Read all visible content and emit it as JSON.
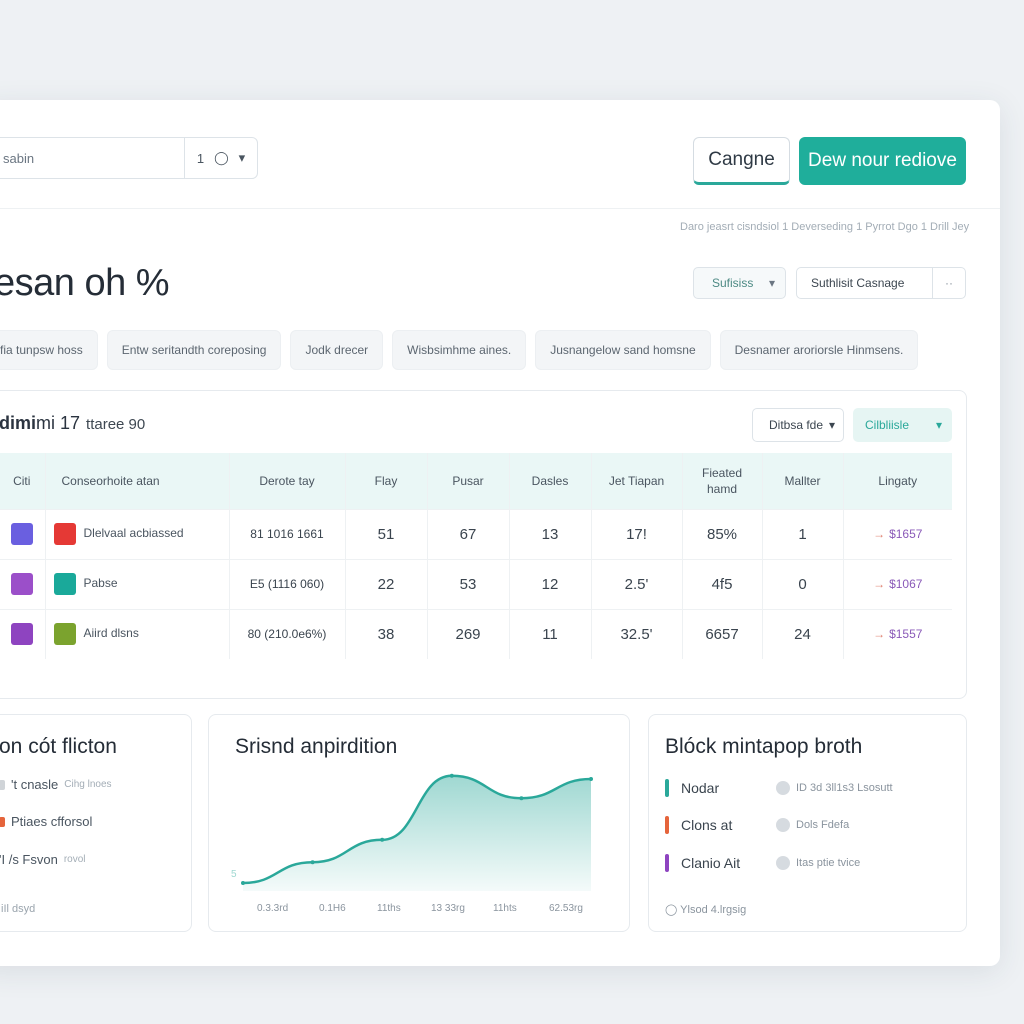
{
  "search": {
    "value": "sabin",
    "stepper_value": "1"
  },
  "actions": {
    "secondary_label": "Cangne",
    "primary_label": "Dew nour rediove"
  },
  "breadcrumbs": "Daro jeasrt  cisndsiol  1  Deverseding  1  Pyrrot Dgo  1  Drill Jey",
  "page_title": "esan oh %",
  "header_selects": {
    "left": "Sufisiss",
    "right": "Suthlisit Casnage"
  },
  "filters": [
    "fia tunpsw hoss",
    "Entw seritandth coreposing",
    "Jodk drecer",
    "Wisbsimhme aines.",
    "Jusnangelow sand homsne",
    "Desnamer aroriorsle Hinmsens."
  ],
  "table_panel": {
    "title_bold": "dimi",
    "title_text": "mi 17",
    "title_sub": "ttaree 90",
    "select1": "Ditbsa fde",
    "select2": "Cilbliisle",
    "columns": [
      "Citi",
      "Conseorhoite atan",
      "Derote tay",
      "Flay",
      "Pusar",
      "Dasles",
      "Jet Tiapan",
      "Fieated hamd",
      "Mallter",
      "Lingaty"
    ],
    "rows": [
      {
        "color": "#6a5fe0",
        "swatch": "#e53935",
        "name": "Dlelvaal acbiassed",
        "range": "81 1016 1661",
        "c3": "51",
        "c4": "67",
        "c5": "13",
        "c6": "17!",
        "c7": "85%",
        "c8": "1",
        "tag": "$1657"
      },
      {
        "color": "#9b4fc9",
        "swatch": "#1aa99a",
        "name": "Pabse",
        "range": "E5 (1116 060)",
        "c3": "22",
        "c4": "53",
        "c5": "12",
        "c6": "2.5'",
        "c7": "4f5",
        "c8": "0",
        "tag": "$1067"
      },
      {
        "color": "#8e44c0",
        "swatch": "#7ba32e",
        "name": "Aiird dlsns",
        "range": "80 (210.0e6%)",
        "c3": "38",
        "c4": "269",
        "c5": "11",
        "c6": "32.5'",
        "c7": "6657",
        "c8": "24",
        "tag": "$1557"
      }
    ]
  },
  "card_left": {
    "title": "on cót flicton",
    "items": [
      {
        "label": "'t cnasle",
        "small": "Cihg  lnoes",
        "color": "#d0d4d8"
      },
      {
        "label": "Ptiaes cfforsol",
        "small": "",
        "color": "#e5643b"
      },
      {
        "label": "'I /s Fsvon",
        "small": "rovol",
        "color": "#3a444e"
      }
    ],
    "footer": "iIl dsyd"
  },
  "card_mid": {
    "title": "Srisnd anpirdition",
    "x_ticks": [
      "0.3.3rd",
      "0.1H6",
      "11ths",
      "13 33rg",
      "11hts",
      "62.53rg"
    ],
    "y_start_label": "5"
  },
  "chart_data": {
    "type": "area",
    "title": "Srisnd anpirdition",
    "x": [
      "0.3.3rd",
      "0.1H6",
      "11ths",
      "13 33rg",
      "11hts",
      "62.53rg"
    ],
    "series": [
      {
        "values": [
          5,
          18,
          32,
          72,
          58,
          70
        ]
      }
    ],
    "ylim": [
      0,
      80
    ],
    "color": "#2aa89a"
  },
  "card_right": {
    "title": "Blóck mintapop broth",
    "items": [
      {
        "label": "Nodar",
        "color": "#2aa89a",
        "value": "ID 3d 3ll1s3 Lsosutt"
      },
      {
        "label": "Clons at",
        "color": "#e5643b",
        "value": "Dols Fdefa"
      },
      {
        "label": "Clanio Ait",
        "color": "#8e44c0",
        "value": "Itas ptie tvice"
      }
    ],
    "footer": "Ylsod 4.lrgsig"
  }
}
